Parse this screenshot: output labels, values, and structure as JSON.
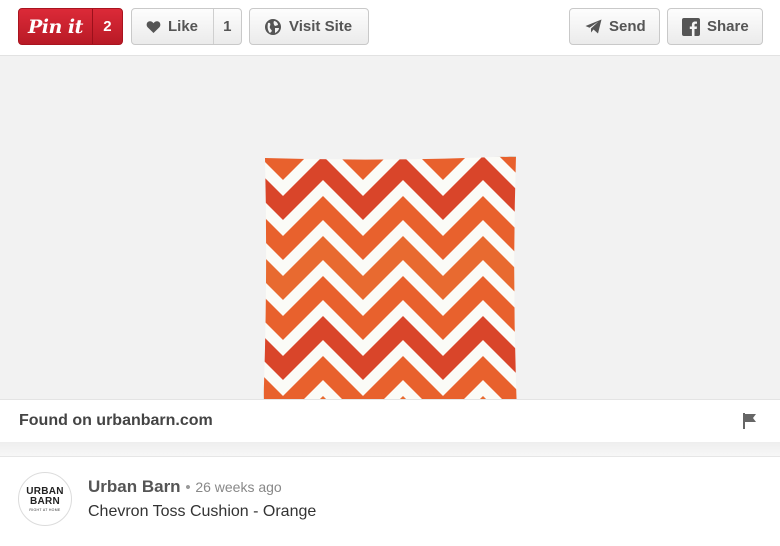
{
  "toolbar": {
    "pin_label": "Pin it",
    "pin_count": "2",
    "like_label": "Like",
    "like_count": "1",
    "visit_label": "Visit Site",
    "send_label": "Send",
    "share_label": "Share"
  },
  "colors": {
    "pin_red": "#cb2027",
    "pillow_orange": "#e85a2a",
    "pillow_white": "#fbfbf7"
  },
  "image": {
    "subject": "chevron pillow image"
  },
  "source": {
    "found_text": "Found on urbanbarn.com"
  },
  "pinner": {
    "avatar_line1": "URBAN",
    "avatar_line2": "BARN",
    "avatar_line3": "RIGHT AT HOME",
    "name": "Urban Barn",
    "separator": "•",
    "time": "26 weeks ago",
    "description": "Chevron Toss Cushion - Orange"
  },
  "icons": {
    "heart": "heart-icon",
    "visit": "world-icon",
    "send": "paper-plane-icon",
    "share": "facebook-icon",
    "flag": "flag-icon"
  }
}
